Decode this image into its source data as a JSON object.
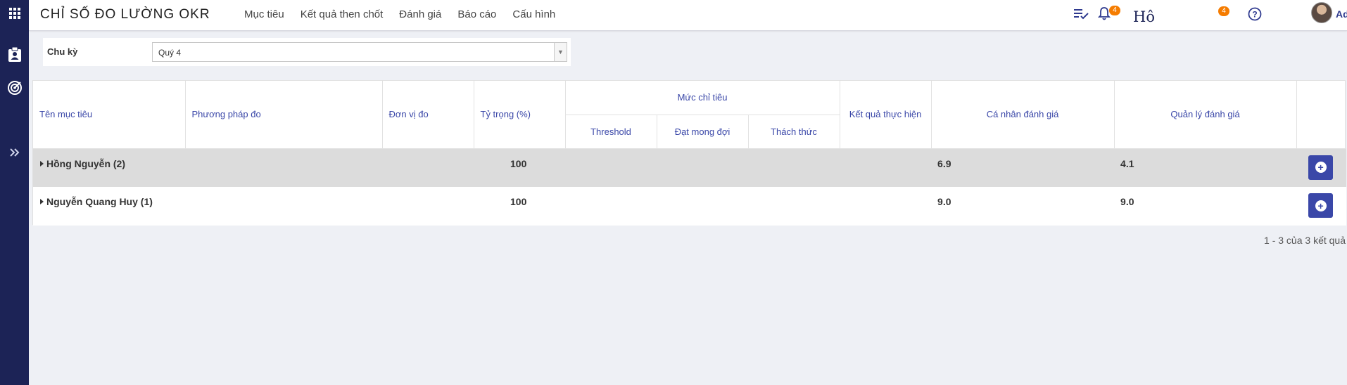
{
  "header": {
    "app_title": "CHỈ SỐ ĐO LƯỜNG OKR",
    "nav": [
      "Mục tiêu",
      "Kết quả then chốt",
      "Đánh giá",
      "Báo cáo",
      "Cấu hình"
    ],
    "task_badge": "4",
    "notif_badge": "4",
    "ho_text": "Hô",
    "user_name": "Admin"
  },
  "filter": {
    "label": "Chu kỳ",
    "selected": "Quý 4"
  },
  "table": {
    "headers": {
      "name": "Tên mục tiêu",
      "method": "Phương pháp đo",
      "unit": "Đơn vị đo",
      "weight": "Tỷ trọng (%)",
      "target_group": "Mức chỉ tiêu",
      "threshold": "Threshold",
      "expected": "Đạt mong đợi",
      "challenge": "Thách thức",
      "result": "Kết quả thực hiện",
      "self_eval": "Cá nhân đánh giá",
      "mgr_eval": "Quản lý đánh giá"
    },
    "rows": [
      {
        "name": "Hồng Nguyễn (2)",
        "weight": "100",
        "self_eval": "6.9",
        "mgr_eval": "4.1"
      },
      {
        "name": "Nguyễn Quang Huy (1)",
        "weight": "100",
        "self_eval": "9.0",
        "mgr_eval": "9.0"
      }
    ]
  },
  "pagination": "1 - 3 của 3 kết quả",
  "colors": {
    "sidebar": "#1c2356",
    "accent": "#3a47a8",
    "badge": "#f57c00"
  }
}
